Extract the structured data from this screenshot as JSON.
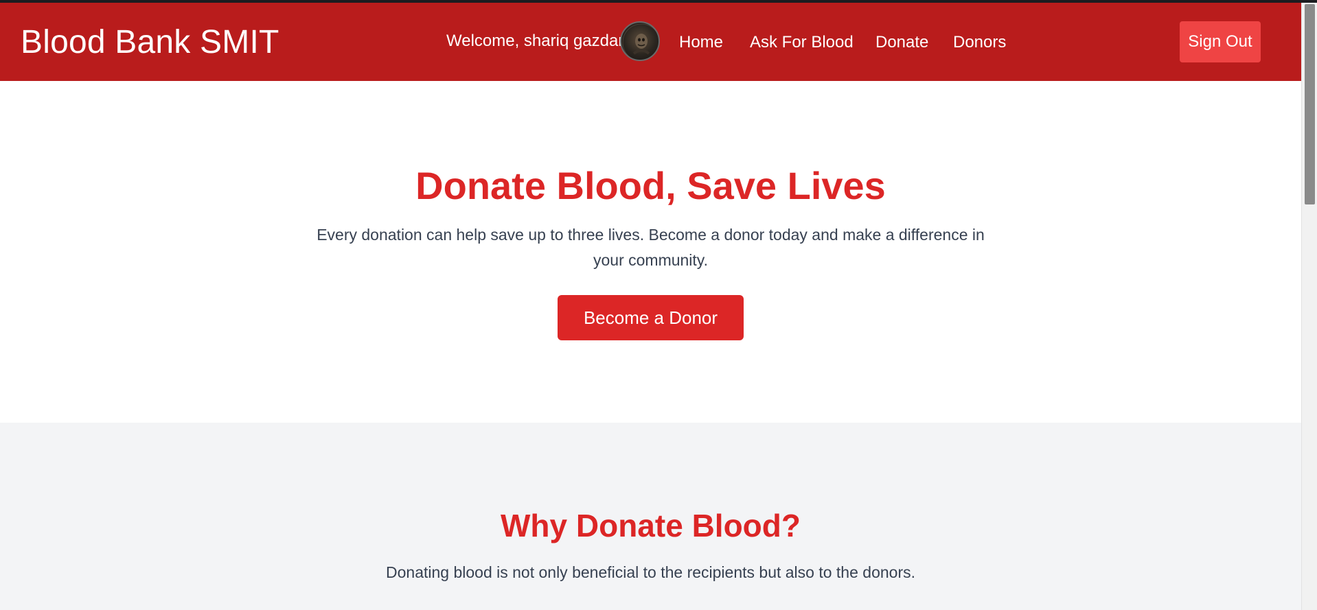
{
  "navbar": {
    "brand": "Blood Bank SMIT",
    "welcome": "Welcome, shariq gazdar",
    "links": [
      "Home",
      "Ask For Blood",
      "Donate",
      "Donors"
    ],
    "signout": "Sign Out",
    "colors": {
      "background": "#b91c1c",
      "signout": "#ef4444"
    }
  },
  "hero": {
    "title": "Donate Blood, Save Lives",
    "text": "Every donation can help save up to three lives. Become a donor today and make a difference in your community.",
    "button": "Become a Donor",
    "accent": "#dc2626"
  },
  "why": {
    "title": "Why Donate Blood?",
    "text": "Donating blood is not only beneficial to the recipients but also to the donors."
  },
  "icons": {
    "avatar": "user-avatar-icon"
  }
}
